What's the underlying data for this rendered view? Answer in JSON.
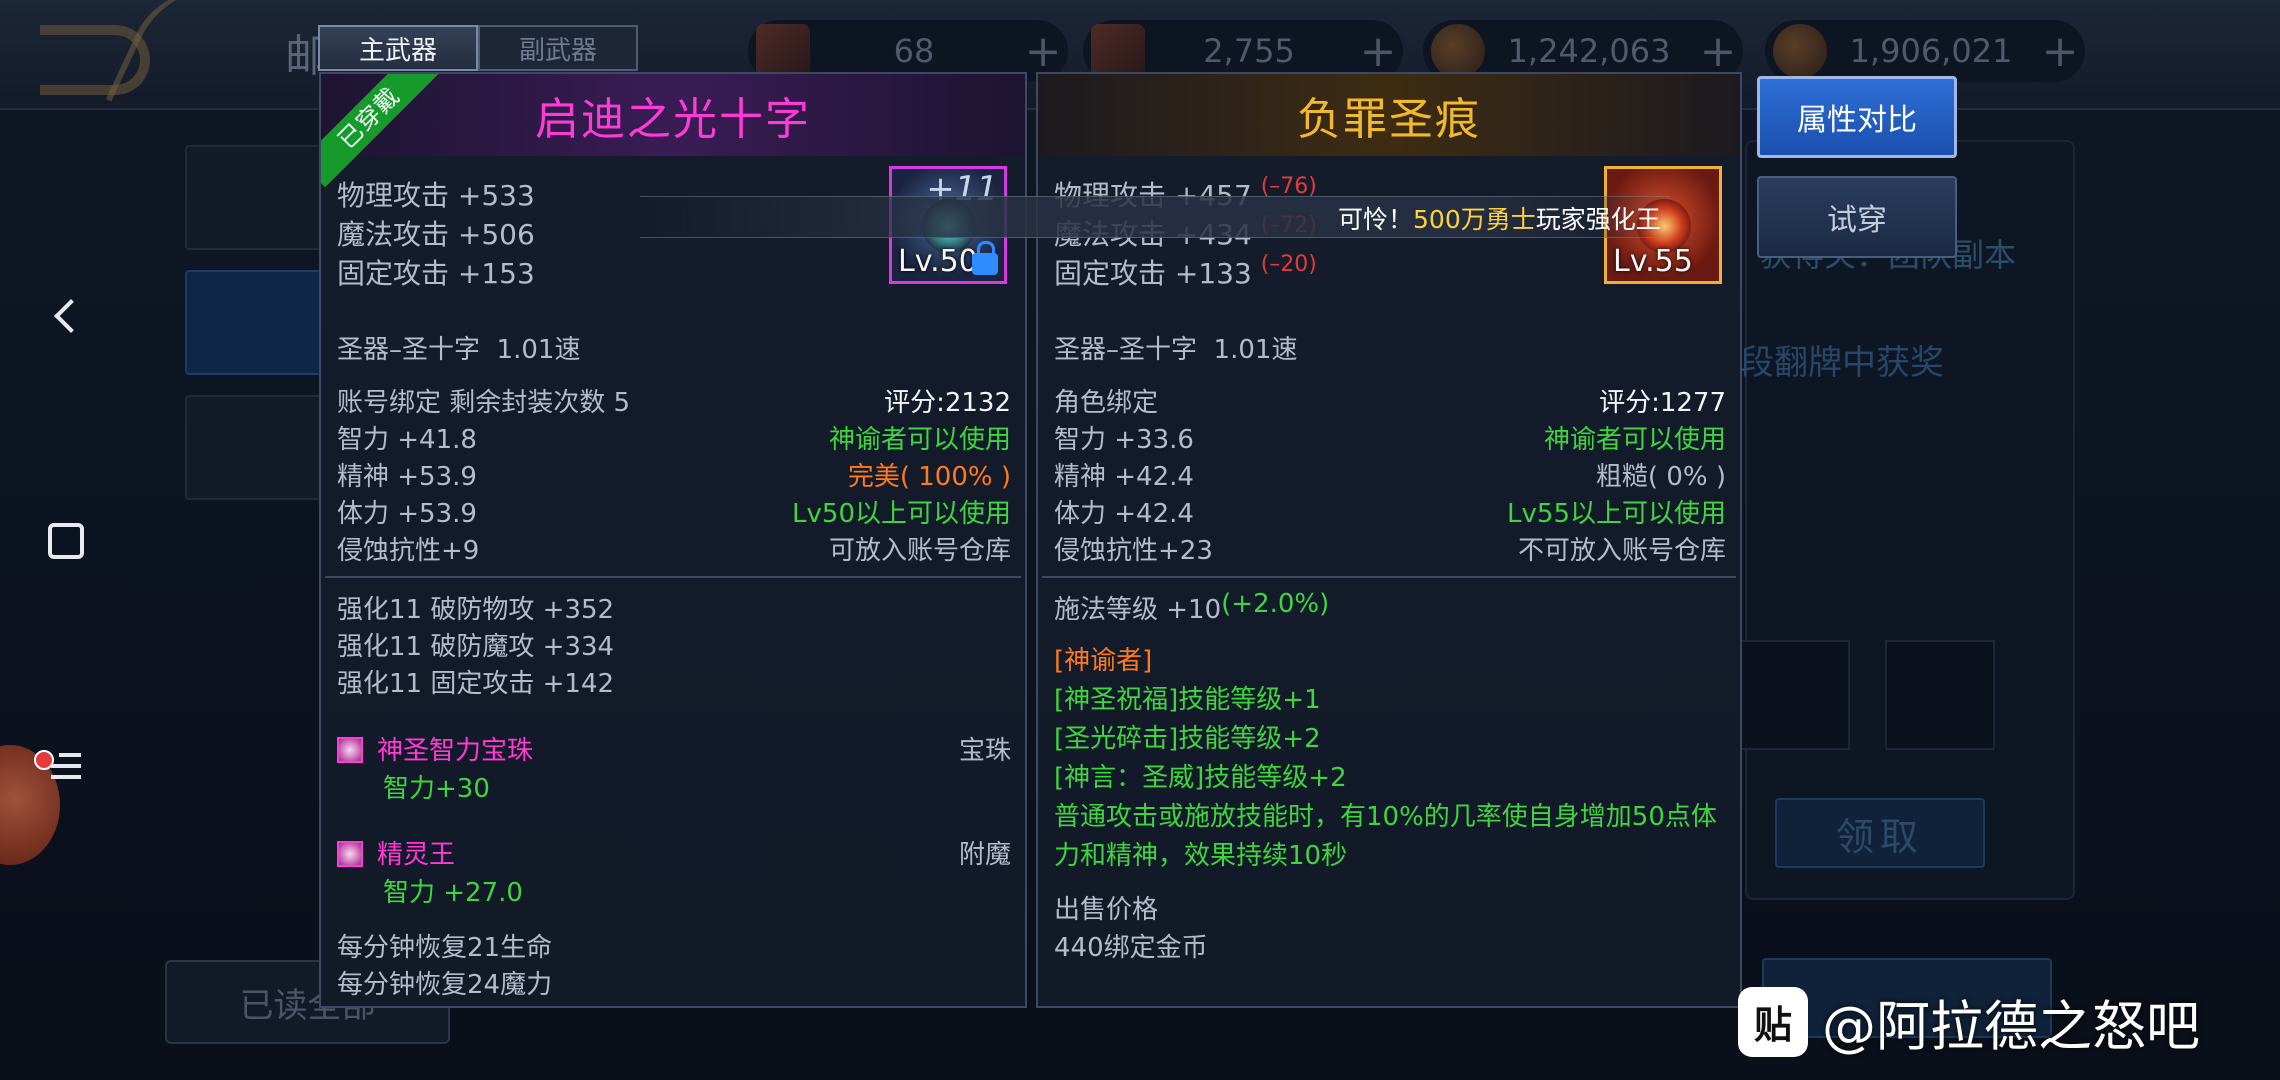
{
  "currencies": [
    {
      "icon": "scroll-icon",
      "value": "68"
    },
    {
      "icon": "scroll-icon",
      "value": "2,755"
    },
    {
      "icon": "gold-coin-icon",
      "value": "1,242,063"
    },
    {
      "icon": "gold-coin-icon",
      "value": "1,906,021"
    }
  ],
  "background": {
    "title": "邮",
    "read_all": "已读全部",
    "receive": "领取",
    "text_dungeon": "获得关：团队副本",
    "text_flip": "段翻牌中获奖"
  },
  "weapon_tabs": {
    "main": "主武器",
    "sub": "副武器"
  },
  "left_item": {
    "ribbon": "已穿戴",
    "name": "启迪之光十字",
    "icon_plus": "+11",
    "icon_level": "Lv.50",
    "stats": [
      "物理攻击 +533",
      "魔法攻击 +506",
      "固定攻击 +153"
    ],
    "type": "圣器–圣十字",
    "speed": "1.01速",
    "binding": "账号绑定 剩余封装次数 5",
    "score": "评分:2132",
    "attrs": [
      {
        "left": "智力 +41.8",
        "right": "神谕者可以使用"
      },
      {
        "left": "精神 +53.9",
        "right": "完美( 100% )"
      },
      {
        "left": "体力 +53.9",
        "right": "Lv50以上可以使用"
      },
      {
        "left": "侵蚀抗性+9",
        "right": "可放入账号仓库"
      }
    ],
    "enhance": [
      "强化11 破防物攻 +352",
      "强化11 破防魔攻 +334",
      "强化11 固定攻击 +142"
    ],
    "gem_name": "神圣智力宝珠",
    "gem_type": "宝珠",
    "gem_stat": "智力+30",
    "enchant_name": "精灵王",
    "enchant_type": "附魔",
    "enchant_stat": "智力 +27.0",
    "regen": [
      "每分钟恢复21生命",
      "每分钟恢复24魔力"
    ]
  },
  "right_item": {
    "name": "负罪圣痕",
    "icon_level": "Lv.55",
    "stats": [
      {
        "text": "物理攻击 +457",
        "diff": "(–76)"
      },
      {
        "text": "魔法攻击 +434",
        "diff": "(–72)"
      },
      {
        "text": "固定攻击 +133",
        "diff": "(–20)"
      }
    ],
    "type": "圣器–圣十字",
    "speed": "1.01速",
    "binding": "角色绑定",
    "score": "评分:1277",
    "attrs": [
      {
        "left": "智力 +33.6",
        "right": "神谕者可以使用"
      },
      {
        "left": "精神 +42.4",
        "right": "粗糙( 0% )"
      },
      {
        "left": "体力 +42.4",
        "right": "Lv55以上可以使用"
      },
      {
        "left": "侵蚀抗性+23",
        "right": "不可放入账号仓库"
      }
    ],
    "cast_level": "施法等级 +10",
    "cast_level_pct": "(+2.0%)",
    "class_tag": "[神谕者]",
    "skills": [
      "[神圣祝福]技能等级+1",
      "[圣光碎击]技能等级+2",
      "[神言：圣威]技能等级+2",
      "普通攻击或施放技能时，有10%的几率使自身增加50点体",
      "力和精神，效果持续10秒"
    ],
    "sell_label": "出售价格",
    "sell_value": "440绑定金币"
  },
  "banner": {
    "prefix": "可怜！",
    "highlight": "500万勇士",
    "suffix": "玩家强化王"
  },
  "buttons": {
    "compare": "属性对比",
    "try_on": "试穿"
  },
  "watermark": {
    "logo": "贴",
    "text": "@阿拉德之怒吧"
  },
  "colors": {
    "epic_name": "#ff3ad7",
    "legend_name": "#f2b92e",
    "positive": "#3ed53e",
    "negative": "#e53a3a",
    "perfect": "#ff7a1a"
  }
}
